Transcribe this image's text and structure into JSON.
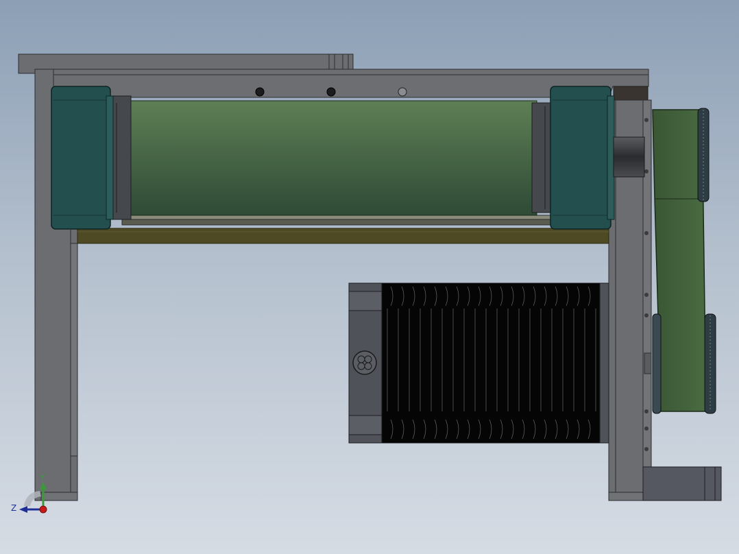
{
  "viewport": {
    "background_top": "#8c9fb5",
    "background_bottom": "#d6dce4"
  },
  "triad": {
    "y_label": "Y",
    "z_label": "Z",
    "colors": {
      "y_axis": "#3a9a3a",
      "z_axis": "#1f2f9a",
      "x_origin": "#c41a1a"
    }
  },
  "model": {
    "colors": {
      "frame": "#6b6d70",
      "frame_edge": "#2c2d30",
      "bearing_block": "#23504e",
      "roller_top": "#5e7f55",
      "roller_bottom": "#2f4a36",
      "base_plate": "#4d4a24",
      "motor_body": "#050505",
      "motor_flange": "#50525a",
      "belt": "#3f5c38",
      "pulley": "#2e3d44",
      "bracket": "#565861"
    }
  }
}
